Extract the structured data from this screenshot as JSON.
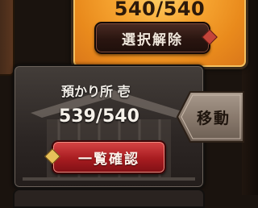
{
  "selected_panel": {
    "count": "540/540",
    "deselect_label": "選択解除"
  },
  "storage": {
    "title": "預かり所 壱",
    "count": "539/540",
    "list_label": "一覧確認",
    "move_label": "移動"
  },
  "colors": {
    "selected_panel": "#f7a632",
    "list_button": "#a71c20",
    "move_tag": "#8a7a6d"
  }
}
